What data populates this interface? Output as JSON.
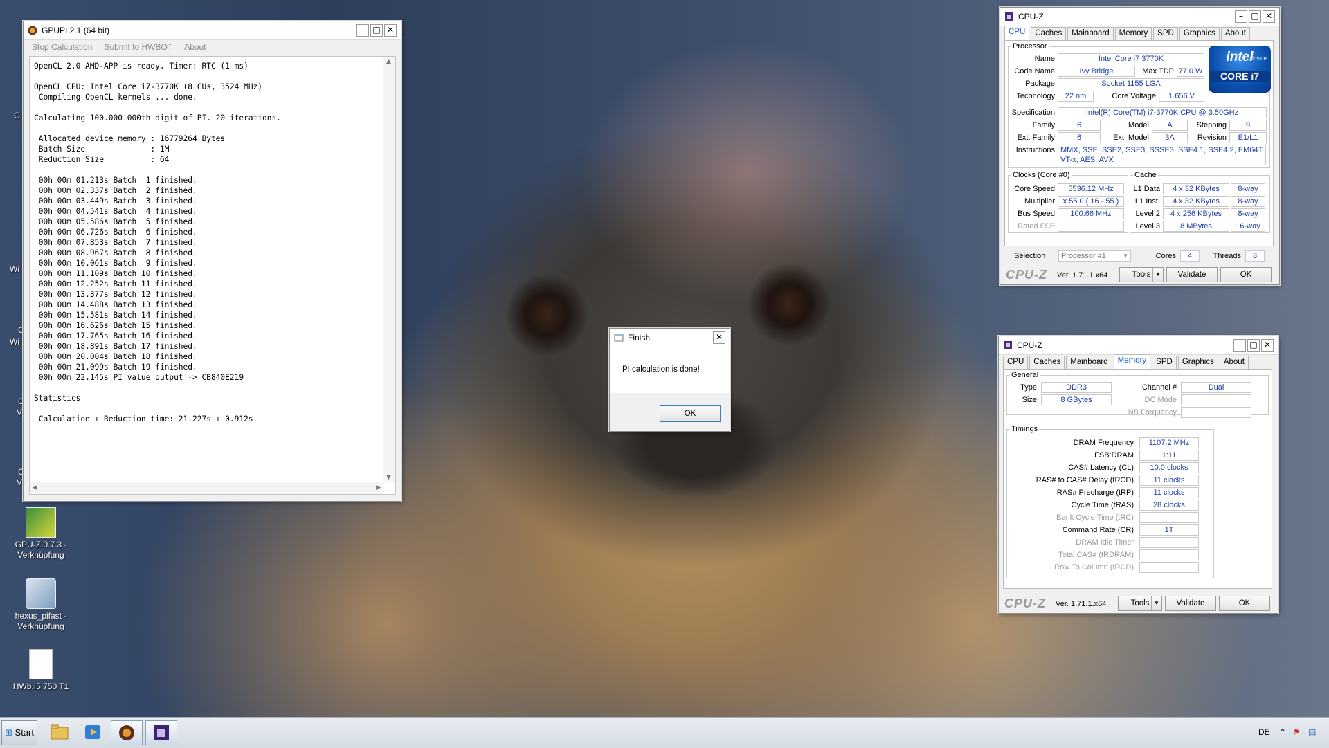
{
  "desktop": {
    "icons": [
      {
        "label_line1": "GPU-Z.0.7.3 -",
        "label_line2": "Verknüpfung",
        "icon": "gpuz-shortcut-icon"
      },
      {
        "label_line1": "hexus_pifast -",
        "label_line2": "Verknüpfung",
        "icon": "hexus-shortcut-icon"
      },
      {
        "label_line1": "HWb.I5 750 T1",
        "label_line2": "",
        "icon": "document-icon"
      }
    ],
    "peek_texts": [
      "C",
      "Wi",
      "C",
      "Wi",
      "C",
      "V",
      "C",
      "V"
    ]
  },
  "gpupi": {
    "title": "GPUPI 2.1 (64 bit)",
    "menu": [
      "Stop Calculation",
      "Submit to HWBOT",
      "About"
    ],
    "console_lines": [
      "OpenCL 2.0 AMD-APP is ready. Timer: RTC (1 ms)",
      "",
      "OpenCL CPU: Intel Core i7-3770K (8 CUs, 3524 MHz)",
      " Compiling OpenCL kernels ... done.",
      "",
      "Calculating 100.000.000th digit of PI. 20 iterations.",
      "",
      " Allocated device memory : 16779264 Bytes",
      " Batch Size              : 1M",
      " Reduction Size          : 64",
      "",
      " 00h 00m 01.213s Batch  1 finished.",
      " 00h 00m 02.337s Batch  2 finished.",
      " 00h 00m 03.449s Batch  3 finished.",
      " 00h 00m 04.541s Batch  4 finished.",
      " 00h 00m 05.586s Batch  5 finished.",
      " 00h 00m 06.726s Batch  6 finished.",
      " 00h 00m 07.853s Batch  7 finished.",
      " 00h 00m 08.967s Batch  8 finished.",
      " 00h 00m 10.061s Batch  9 finished.",
      " 00h 00m 11.109s Batch 10 finished.",
      " 00h 00m 12.252s Batch 11 finished.",
      " 00h 00m 13.377s Batch 12 finished.",
      " 00h 00m 14.488s Batch 13 finished.",
      " 00h 00m 15.581s Batch 14 finished.",
      " 00h 00m 16.626s Batch 15 finished.",
      " 00h 00m 17.765s Batch 16 finished.",
      " 00h 00m 18.891s Batch 17 finished.",
      " 00h 00m 20.004s Batch 18 finished.",
      " 00h 00m 21.099s Batch 19 finished.",
      " 00h 00m 22.145s PI value output -> CB840E219",
      "",
      "Statistics",
      "",
      " Calculation + Reduction time: 21.227s + 0.912s"
    ]
  },
  "finish_dialog": {
    "title": "Finish",
    "message": "PI calculation is done!",
    "ok_label": "OK"
  },
  "cpuz_cpu": {
    "title": "CPU-Z",
    "tabs": [
      "CPU",
      "Caches",
      "Mainboard",
      "Memory",
      "SPD",
      "Graphics",
      "About"
    ],
    "active_tab": "CPU",
    "processor": {
      "legend": "Processor",
      "name_label": "Name",
      "name": "Intel Core i7 3770K",
      "codename_label": "Code Name",
      "codename": "Ivy Bridge",
      "maxtdp_label": "Max TDP",
      "maxtdp": "77.0 W",
      "package_label": "Package",
      "package": "Socket 1155 LGA",
      "technology_label": "Technology",
      "technology": "22 nm",
      "corevoltage_label": "Core Voltage",
      "corevoltage": "1.656 V",
      "spec_label": "Specification",
      "spec": "Intel(R) Core(TM) i7-3770K CPU @ 3.50GHz",
      "family_label": "Family",
      "family": "6",
      "model_label": "Model",
      "model": "A",
      "stepping_label": "Stepping",
      "stepping": "9",
      "extfamily_label": "Ext. Family",
      "extfamily": "6",
      "extmodel_label": "Ext. Model",
      "extmodel": "3A",
      "revision_label": "Revision",
      "revision": "E1/L1",
      "instructions_label": "Instructions",
      "instructions_line1": "MMX, SSE, SSE2, SSE3, SSSE3, SSE4.1, SSE4.2, EM64T,",
      "instructions_line2": "VT-x, AES, AVX",
      "badge_word": "intel",
      "badge_inside": "inside",
      "badge_model": "CORE i7"
    },
    "clocks": {
      "legend": "Clocks (Core #0)",
      "corespeed_label": "Core Speed",
      "corespeed": "5536.12 MHz",
      "multiplier_label": "Multiplier",
      "multiplier": "x 55.0 ( 16 - 55 )",
      "busspeed_label": "Bus Speed",
      "busspeed": "100.66 MHz",
      "ratedfsb_label": "Rated FSB",
      "ratedfsb": ""
    },
    "cache": {
      "legend": "Cache",
      "rows": [
        {
          "label": "L1 Data",
          "size": "4 x 32 KBytes",
          "ways": "8-way"
        },
        {
          "label": "L1 Inst.",
          "size": "4 x 32 KBytes",
          "ways": "8-way"
        },
        {
          "label": "Level 2",
          "size": "4 x 256 KBytes",
          "ways": "8-way"
        },
        {
          "label": "Level 3",
          "size": "8 MBytes",
          "ways": "16-way"
        }
      ]
    },
    "selection_label": "Selection",
    "selection": "Processor #1",
    "cores_label": "Cores",
    "cores": "4",
    "threads_label": "Threads",
    "threads": "8",
    "brand": "CPU-Z",
    "version": "Ver. 1.71.1.x64",
    "tools_label": "Tools",
    "validate_label": "Validate",
    "ok_label": "OK"
  },
  "cpuz_mem": {
    "title": "CPU-Z",
    "tabs": [
      "CPU",
      "Caches",
      "Mainboard",
      "Memory",
      "SPD",
      "Graphics",
      "About"
    ],
    "active_tab": "Memory",
    "general": {
      "legend": "General",
      "type_label": "Type",
      "type": "DDR3",
      "size_label": "Size",
      "size": "8 GBytes",
      "channel_label": "Channel #",
      "channel": "Dual",
      "dcmode_label": "DC Mode",
      "dcmode": "",
      "nbfreq_label": "NB Frequency",
      "nbfreq": ""
    },
    "timings": {
      "legend": "Timings",
      "rows": [
        {
          "label": "DRAM Frequency",
          "value": "1107.2 MHz",
          "dim": false
        },
        {
          "label": "FSB:DRAM",
          "value": "1:11",
          "dim": false
        },
        {
          "label": "CAS# Latency (CL)",
          "value": "10.0 clocks",
          "dim": false
        },
        {
          "label": "RAS# to CAS# Delay (tRCD)",
          "value": "11 clocks",
          "dim": false
        },
        {
          "label": "RAS# Precharge (tRP)",
          "value": "11 clocks",
          "dim": false
        },
        {
          "label": "Cycle Time (tRAS)",
          "value": "28 clocks",
          "dim": false
        },
        {
          "label": "Bank Cycle Time (tRC)",
          "value": "",
          "dim": true
        },
        {
          "label": "Command Rate (CR)",
          "value": "1T",
          "dim": false
        },
        {
          "label": "DRAM Idle Timer",
          "value": "",
          "dim": true
        },
        {
          "label": "Total CAS# (tRDRAM)",
          "value": "",
          "dim": true
        },
        {
          "label": "Row To Column (tRCD)",
          "value": "",
          "dim": true
        }
      ]
    },
    "brand": "CPU-Z",
    "version": "Ver. 1.71.1.x64",
    "tools_label": "Tools",
    "validate_label": "Validate",
    "ok_label": "OK"
  },
  "taskbar": {
    "start_label": "Start",
    "items": [
      "explorer-icon",
      "media-player-icon",
      "gpupi-icon",
      "cpuz-icon"
    ],
    "language": "DE"
  }
}
